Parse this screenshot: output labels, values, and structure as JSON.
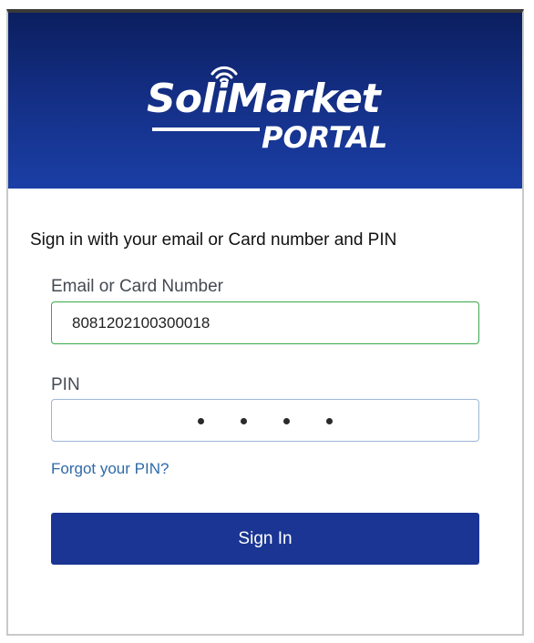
{
  "header": {
    "logo_main": "SoliMarket",
    "logo_sub": "PORTAL",
    "background_top": "#0b1f5f",
    "background_bottom": "#1b3fa6"
  },
  "form": {
    "prompt": "Sign in with your email or Card number and PIN",
    "email_label": "Email or Card Number",
    "email_value": "8081202100300018",
    "pin_label": "PIN",
    "pin_masked_length": 4,
    "forgot_link": "Forgot your PIN?",
    "signin_button": "Sign In"
  },
  "colors": {
    "accent": "#1a3593",
    "link": "#2f6aa8",
    "valid_border": "#39a84a"
  },
  "icons": {
    "logo_signal": "wifi-signal-icon"
  }
}
